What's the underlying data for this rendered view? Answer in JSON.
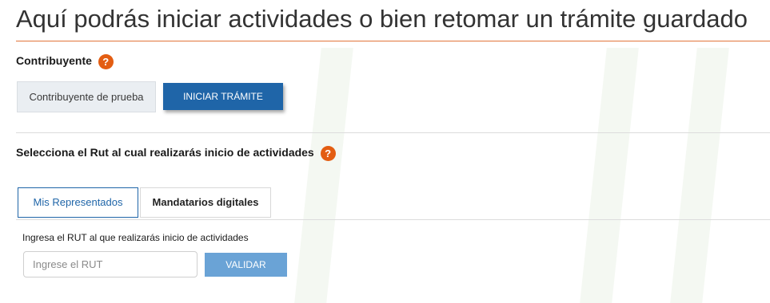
{
  "page": {
    "title": "Aquí podrás iniciar actividades o bien retomar un trámite guardado"
  },
  "contribuyente": {
    "label": "Contribuyente",
    "help": "?",
    "value": "Contribuyente de prueba",
    "start_button": "INICIAR TRÁMITE"
  },
  "rut_section": {
    "label": "Selecciona el Rut al cual realizarás inicio de actividades",
    "help": "?",
    "tabs": [
      {
        "label": "Mis Representados",
        "active": true
      },
      {
        "label": "Mandatarios digitales",
        "active": false
      }
    ],
    "field_label": "Ingresa el RUT al que realizarás inicio de actividades",
    "input_placeholder": "Ingrese el RUT",
    "input_value": "",
    "validate_button": "VALIDAR"
  },
  "colors": {
    "accent_orange": "#e35d12",
    "primary_blue": "#1f65a8",
    "disabled_blue": "#6aa3d6",
    "title_rule": "#e2753a"
  }
}
